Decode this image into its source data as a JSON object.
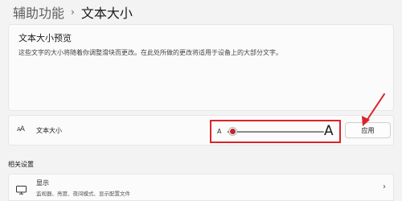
{
  "breadcrumb": {
    "parent": "辅助功能",
    "separator": "›",
    "current": "文本大小"
  },
  "preview": {
    "title": "文本大小预览",
    "text": "这些文字的大小将随着你调整滑块而更改。在此处所做的更改将适用于设备上的大部分文字。"
  },
  "text_size": {
    "icon": "text-size-icon",
    "label": "文本大小",
    "slider_min_label": "A",
    "slider_max_label": "A",
    "slider_value_fraction": 0.05,
    "apply_label": "应用",
    "highlight_color": "#d9252a",
    "thumb_color": "#c0262b"
  },
  "related": {
    "header": "相关设置",
    "items": [
      {
        "icon": "monitor-icon",
        "title": "显示",
        "subtitle": "监视器、亮度、夜间模式、显示配置文件",
        "chevron": "›"
      }
    ]
  }
}
